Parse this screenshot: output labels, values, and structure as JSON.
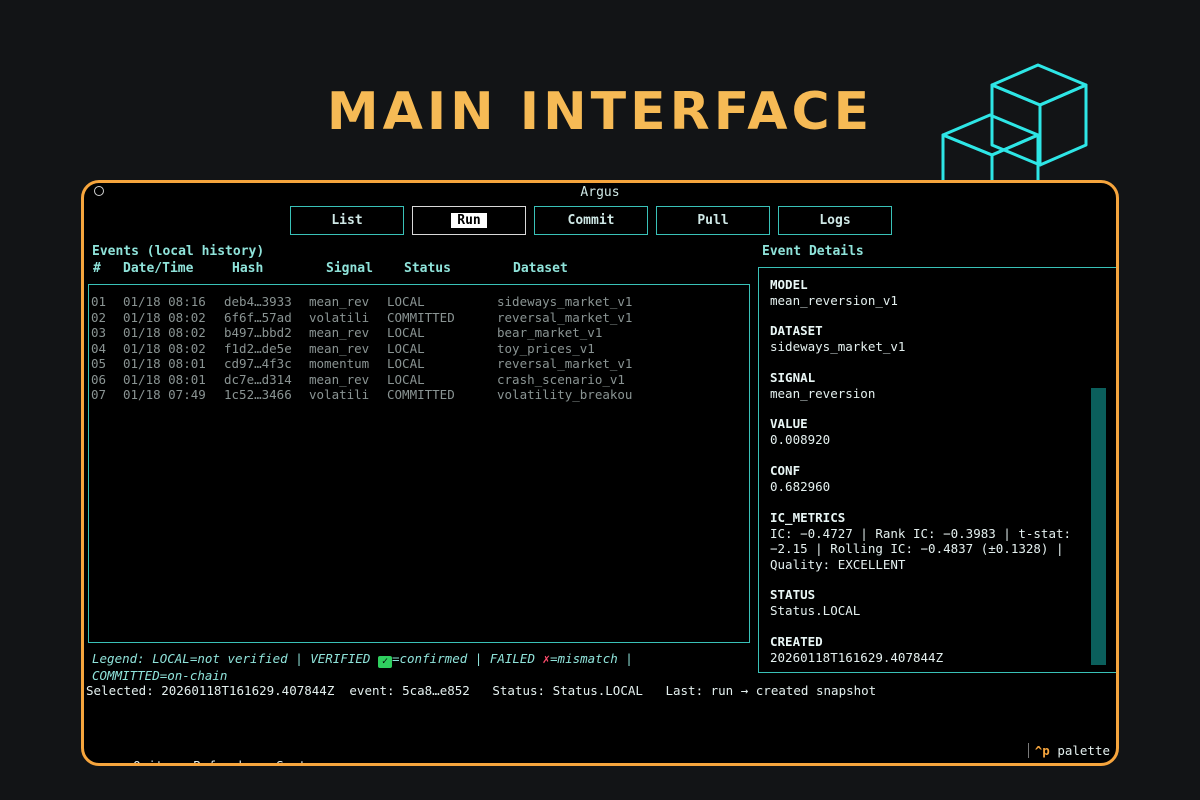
{
  "headline": "MAIN INTERFACE",
  "window": {
    "title": "Argus"
  },
  "tabs": [
    {
      "label": "List"
    },
    {
      "label": "Run"
    },
    {
      "label": "Commit"
    },
    {
      "label": "Pull"
    },
    {
      "label": "Logs"
    }
  ],
  "active_tab": "Run",
  "events": {
    "title": "Events (local history)",
    "columns": [
      "#",
      "Date/Time",
      "Hash",
      "Signal",
      "Status",
      "Dataset"
    ],
    "rows": [
      [
        "01",
        "01/18 08:16",
        "deb4…3933",
        "mean_rev",
        "LOCAL",
        "sideways_market_v1"
      ],
      [
        "02",
        "01/18 08:02",
        "6f6f…57ad",
        "volatili",
        "COMMITTED",
        "reversal_market_v1"
      ],
      [
        "03",
        "01/18 08:02",
        "b497…bbd2",
        "mean_rev",
        "LOCAL",
        "bear_market_v1"
      ],
      [
        "04",
        "01/18 08:02",
        "f1d2…de5e",
        "mean_rev",
        "LOCAL",
        "toy_prices_v1"
      ],
      [
        "05",
        "01/18 08:01",
        "cd97…4f3c",
        "momentum",
        "LOCAL",
        "reversal_market_v1"
      ],
      [
        "06",
        "01/18 08:01",
        "dc7e…d314",
        "mean_rev",
        "LOCAL",
        "crash_scenario_v1"
      ],
      [
        "07",
        "01/18 07:49",
        "1c52…3466",
        "volatili",
        "COMMITTED",
        "volatility_breakou"
      ]
    ]
  },
  "legend": {
    "part1": "Legend: LOCAL=not verified | VERIFIED ",
    "ok_icon": "✓",
    "part2": "=confirmed | FAILED ",
    "bad_icon": "✗",
    "part3": "=mismatch |",
    "line2": "COMMITTED=on-chain"
  },
  "selected_line": "Selected: 20260118T161629.407844Z  event: 5ca8…e852   Status: Status.LOCAL   Last: run → created snapshot",
  "details": {
    "title": "Event Details",
    "fields": [
      {
        "label": "MODEL",
        "value": "mean_reversion_v1"
      },
      {
        "label": "DATASET",
        "value": "sideways_market_v1"
      },
      {
        "label": "SIGNAL",
        "value": "mean_reversion"
      },
      {
        "label": "VALUE",
        "value": "0.008920"
      },
      {
        "label": "CONF",
        "value": "0.682960"
      },
      {
        "label": "IC_METRICS",
        "value_lines": [
          "IC: −0.4727 | Rank IC: −0.3983 | t-stat:",
          "−2.15 | Rolling IC: −0.4837 (±0.1328) |",
          "Quality: EXCELLENT"
        ]
      },
      {
        "label": "STATUS",
        "value": "Status.LOCAL"
      },
      {
        "label": "CREATED",
        "value": "20260118T161629.407844Z"
      }
    ]
  },
  "footer": {
    "items": [
      {
        "key": "q",
        "label": "Quit"
      },
      {
        "key": "r",
        "label": "Refresh"
      },
      {
        "key": "s",
        "label": "Sort"
      }
    ],
    "palette_key": "^p",
    "palette_label": "palette"
  },
  "colors": {
    "accent_orange": "#f6a53d",
    "headline": "#f6ba55",
    "teal_border": "#39c1b8",
    "cube": "#2ee6e6",
    "scrollbar": "#0b5f5c"
  }
}
